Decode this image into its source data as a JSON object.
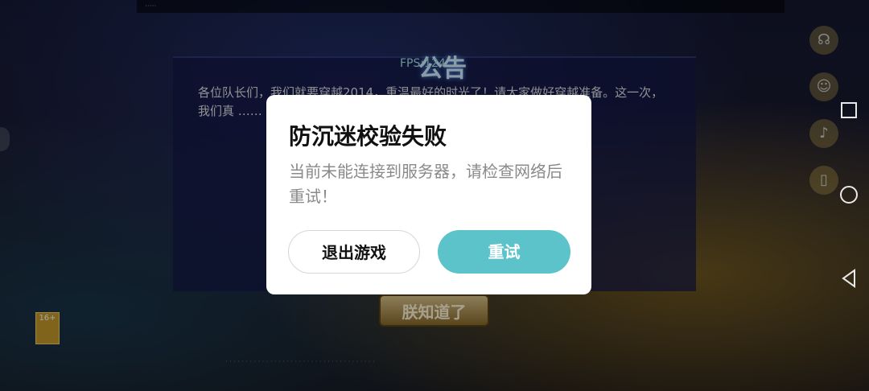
{
  "game": {
    "notice_title": "公告",
    "fps_label": "FPS:124",
    "announcement": "各位队长们，我们就要穿越2014，重温最好的时光了！请大家做好穿越准备。这一次，我们真 …… 动。感谢各位队长，一路 ……",
    "confirm_button": "朕知道了",
    "age_rating": "16+"
  },
  "dialog": {
    "title": "防沉迷校验失败",
    "message": "当前未能连接到服务器，请检查网络后重试！",
    "exit_button": "退出游戏",
    "retry_button": "重试"
  },
  "colors": {
    "retry_accent": "#5bc3c9",
    "dialog_bg": "#ffffff"
  },
  "icons": {
    "right_tools": [
      "headset-icon",
      "person-icon",
      "speaker-icon",
      "phone-icon"
    ],
    "nav": [
      "square-recent-icon",
      "circle-home-icon",
      "triangle-back-icon"
    ]
  }
}
